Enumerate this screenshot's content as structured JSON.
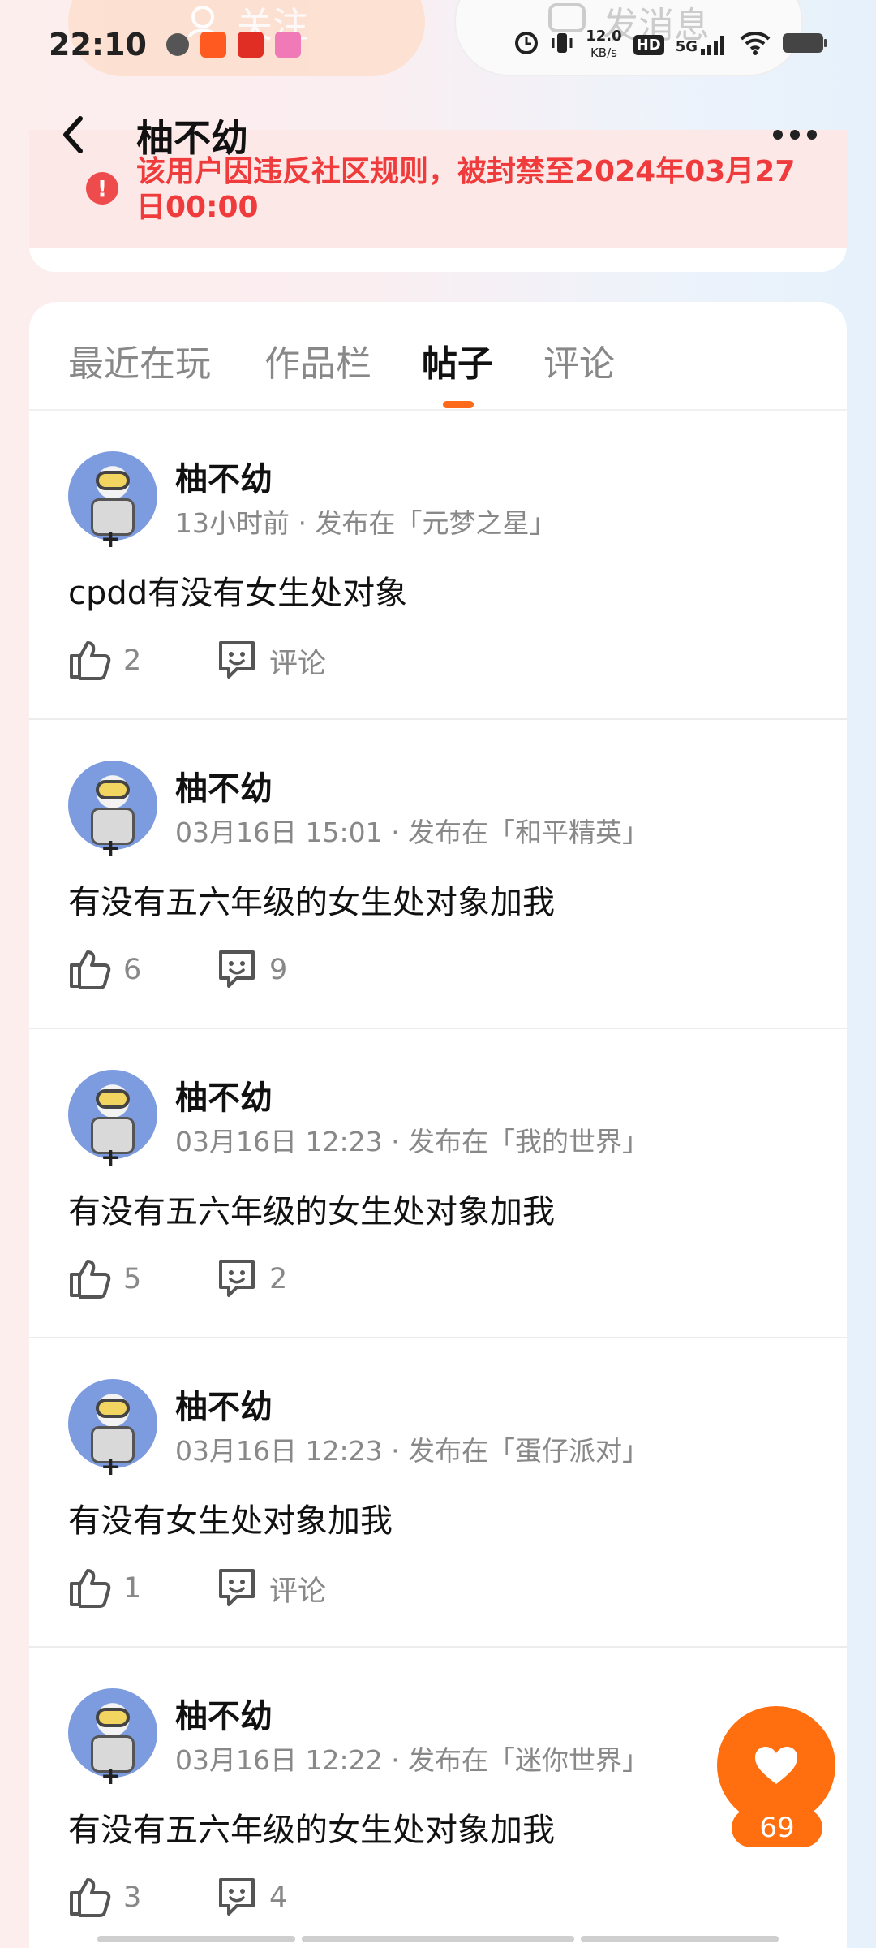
{
  "ghost_buttons": {
    "follow": "关注",
    "message": "发消息"
  },
  "status_bar": {
    "time": "22:10",
    "net_speed": "12.0",
    "net_unit": "KB/s",
    "hd": "HD",
    "network": "5G"
  },
  "header": {
    "title": "柚不幼"
  },
  "ban_notice": {
    "text": "该用户因违反社区规则，被封禁至2024年03月27日00:00"
  },
  "tabs": [
    {
      "label": "最近在玩"
    },
    {
      "label": "作品栏"
    },
    {
      "label": "帖子"
    },
    {
      "label": "评论"
    }
  ],
  "active_tab": "帖子",
  "posts": [
    {
      "author": "柚不幼",
      "meta": "13小时前 · 发布在「元梦之星」",
      "content": "cpdd有没有女生处对象",
      "likes": "2",
      "comments": "评论"
    },
    {
      "author": "柚不幼",
      "meta": "03月16日 15:01 · 发布在「和平精英」",
      "content": "有没有五六年级的女生处对象加我",
      "likes": "6",
      "comments": "9"
    },
    {
      "author": "柚不幼",
      "meta": "03月16日 12:23 · 发布在「我的世界」",
      "content": "有没有五六年级的女生处对象加我",
      "likes": "5",
      "comments": "2"
    },
    {
      "author": "柚不幼",
      "meta": "03月16日 12:23 · 发布在「蛋仔派对」",
      "content": "有没有女生处对象加我",
      "likes": "1",
      "comments": "评论"
    },
    {
      "author": "柚不幼",
      "meta": "03月16日 12:22 · 发布在「迷你世界」",
      "content": "有没有五六年级的女生处对象加我",
      "likes": "3",
      "comments": "4"
    }
  ],
  "floating_like": {
    "count": "69"
  },
  "colors": {
    "accent": "#ff6f0f",
    "ban_red": "#ef3b3b",
    "ban_bg": "#fde8e8"
  }
}
